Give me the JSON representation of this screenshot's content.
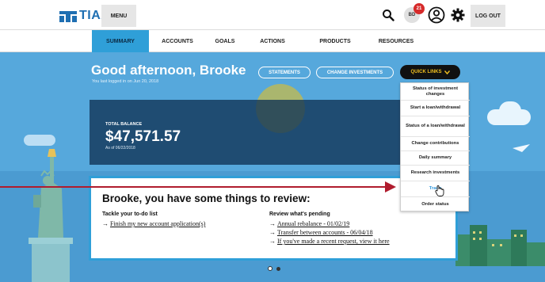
{
  "header": {
    "logo_text": "TIAA",
    "menu_label": "MENU",
    "user_initials": "BD",
    "notification_count": "21",
    "logout_label": "LOG OUT"
  },
  "nav": {
    "items": [
      {
        "label": "SUMMARY",
        "active": true
      },
      {
        "label": "ACCOUNTS",
        "active": false
      },
      {
        "label": "GOALS",
        "active": false
      },
      {
        "label": "ACTIONS",
        "active": false
      },
      {
        "label": "PRODUCTS",
        "active": false
      },
      {
        "label": "RESOURCES",
        "active": false
      }
    ]
  },
  "hero": {
    "greeting": "Good afternoon, Brooke",
    "last_login": "You last logged in on Jun 20, 2018",
    "statements_label": "STATEMENTS",
    "change_investments_label": "CHANGE INVESTMENTS",
    "quick_links_label": "QUICK LINKS"
  },
  "balance": {
    "label": "TOTAL BALANCE",
    "value": "$47,571.57",
    "as_of": "As of 06/22/2018"
  },
  "quick_links": {
    "items": [
      "Status of investment changes",
      "Start a loan/withdrawal",
      "Status of a loan/withdrawal",
      "Change contributions",
      "Daily summary",
      "Research investments",
      "Trade",
      "Order status"
    ],
    "hovered": "Trade"
  },
  "review": {
    "title": "Brooke, you have some things to review:",
    "todo_heading": "Tackle your to-do list",
    "todo_items": [
      "Finish my new account application(s)"
    ],
    "pending_heading": "Review what's pending",
    "pending_items": [
      "Annual rebalance - 01/02/19",
      "Transfer between accounts - 06/04/18",
      "If you've made a recent request, view it here"
    ]
  },
  "carousel": {
    "slide_count": 2,
    "active_index": 1
  },
  "colors": {
    "brand_blue": "#1f6fb2",
    "nav_active": "#2f9fd8",
    "hero_sky": "#56a8dc",
    "quick_links_text": "#f0c020",
    "annotation_red": "#b01c2e",
    "notification_red": "#d62a2a"
  },
  "icons": [
    "tiaa-logo-icon",
    "search-icon",
    "user-badge-icon",
    "profile-icon",
    "gear-icon",
    "chevron-down-icon",
    "arrow-right-icon",
    "hand-cursor-icon"
  ]
}
